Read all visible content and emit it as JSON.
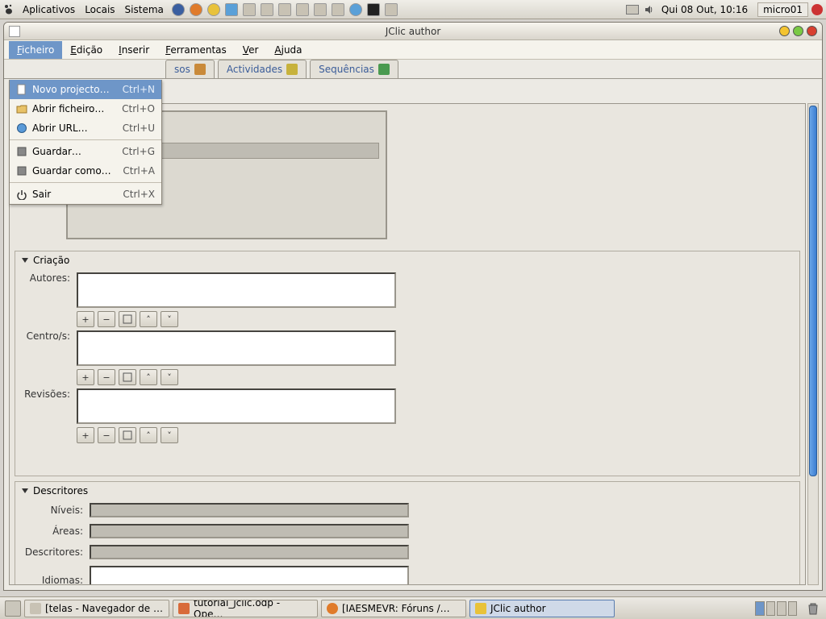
{
  "gnome": {
    "menus": [
      "Aplicativos",
      "Locais",
      "Sistema"
    ],
    "clock": "Qui 08 Out, 10:16",
    "host": "micro01"
  },
  "window": {
    "title": "JClic author"
  },
  "menubar": {
    "items": [
      {
        "label": "Ficheiro",
        "ul": "F"
      },
      {
        "label": "Edição",
        "ul": "E"
      },
      {
        "label": "Inserir",
        "ul": "I"
      },
      {
        "label": "Ferramentas",
        "ul": "F"
      },
      {
        "label": "Ver",
        "ul": "V"
      },
      {
        "label": "Ajuda",
        "ul": "A"
      }
    ]
  },
  "dropdown": {
    "items": [
      {
        "label": "Novo projecto…",
        "shortcut": "Ctrl+N",
        "selected": true
      },
      {
        "label": "Abrir ficheiro…",
        "shortcut": "Ctrl+O"
      },
      {
        "label": "Abrir URL…",
        "shortcut": "Ctrl+U"
      },
      {
        "sep": true
      },
      {
        "label": "Guardar…",
        "shortcut": "Ctrl+G"
      },
      {
        "label": "Guardar como…",
        "shortcut": "Ctrl+A"
      },
      {
        "sep": true
      },
      {
        "label": "Sair",
        "shortcut": "Ctrl+X"
      }
    ]
  },
  "tabs": {
    "visible": [
      {
        "label": "sos"
      },
      {
        "label": "Actividades"
      },
      {
        "label": "Sequências"
      }
    ]
  },
  "sections": {
    "criacao": {
      "title": "Criação",
      "rows": [
        "Autores:",
        "Centro/s:",
        "Revisões:"
      ]
    },
    "descritores": {
      "title": "Descritores",
      "rows": [
        "Níveis:",
        "Áreas:",
        "Descritores:",
        "Idiomas:"
      ]
    }
  },
  "buttons": {
    "plus": "+",
    "minus": "−",
    "edit": "✎",
    "up": "˄",
    "down": "˅"
  },
  "taskbar": {
    "items": [
      {
        "label": "[telas - Navegador de …"
      },
      {
        "label": "tutorial_jclic.odp - Ope…"
      },
      {
        "label": "[IAESMEVR: Fóruns /…"
      },
      {
        "label": "JClic author",
        "active": true
      }
    ]
  }
}
